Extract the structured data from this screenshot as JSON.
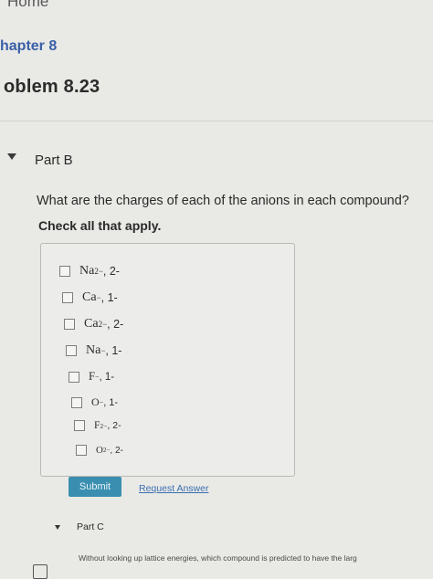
{
  "breadcrumb": {
    "home": "Home"
  },
  "chapter": "hapter 8",
  "problem": "oblem 8.23",
  "part_b": {
    "label": "Part B",
    "question": "What are the charges of each of the anions in each compound?",
    "instruction": "Check all that apply.",
    "options": [
      {
        "ion": "Na",
        "sup": "2−",
        "charge": ", 2-"
      },
      {
        "ion": "Ca",
        "sup": "−",
        "charge": ", 1-"
      },
      {
        "ion": "Ca",
        "sup": "2−",
        "charge": ", 2-"
      },
      {
        "ion": "Na",
        "sup": "−",
        "charge": ", 1-"
      },
      {
        "ion": "F",
        "sup": "−",
        "charge": ", 1-"
      },
      {
        "ion": "O",
        "sup": "−",
        "charge": ", 1-"
      },
      {
        "ion": "F",
        "sup": "2−",
        "charge": ", 2-"
      },
      {
        "ion": "O",
        "sup": "2−",
        "charge": ", 2-"
      }
    ],
    "submit_label": "Submit",
    "request_answer_label": "Request Answer"
  },
  "part_c": {
    "label": "Part C",
    "question_fragment": "Without looking up lattice energies, which compound is predicted to have the larg"
  }
}
